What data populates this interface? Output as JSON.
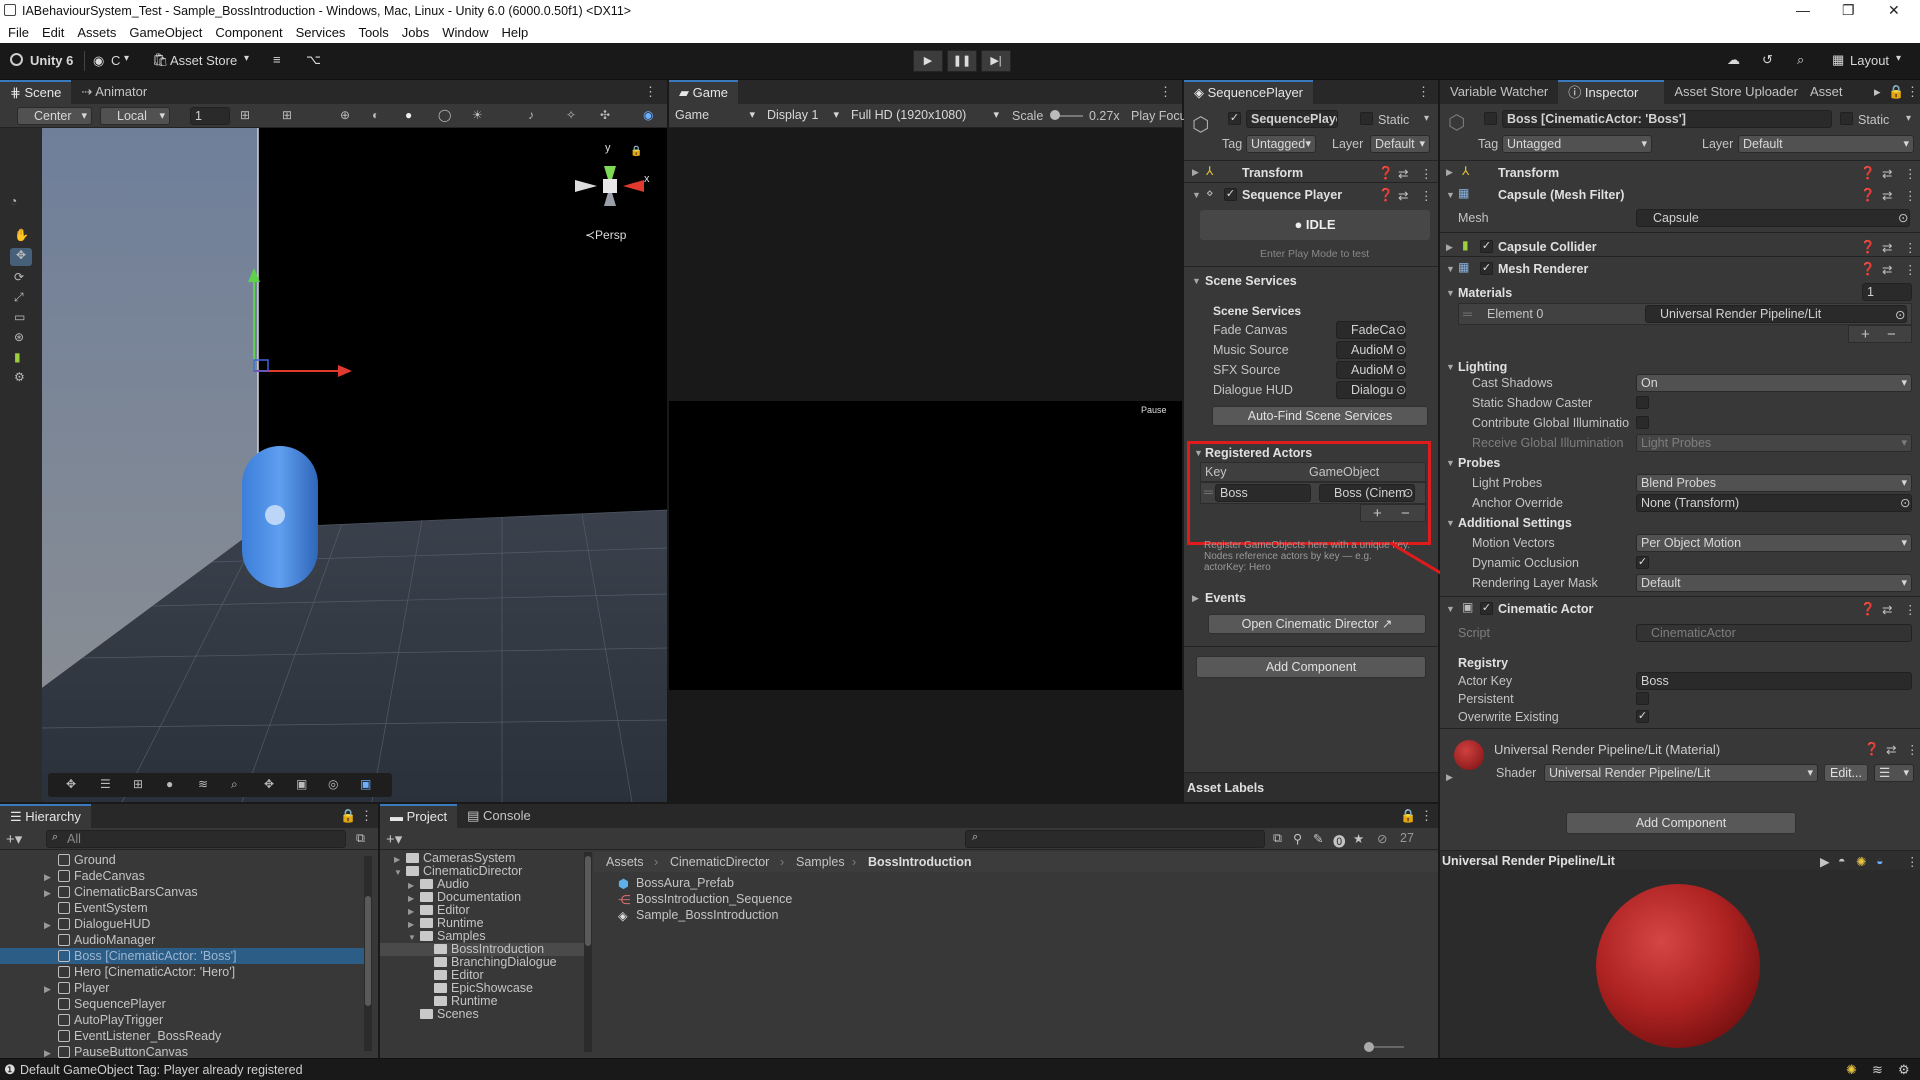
{
  "window": {
    "title": "IABehaviourSystem_Test - Sample_BossIntroduction - Windows, Mac, Linux - Unity 6.0 (6000.0.50f1) <DX11>"
  },
  "menu": [
    "File",
    "Edit",
    "Assets",
    "GameObject",
    "Component",
    "Services",
    "Tools",
    "Jobs",
    "Window",
    "Help"
  ],
  "toolbar": {
    "unity_label": "Unity 6",
    "account_label": "C",
    "asset_store": "Asset Store",
    "layout": "Layout"
  },
  "scene": {
    "tabs": {
      "scene": "Scene",
      "animator": "Animator"
    },
    "pivot": "Center",
    "space": "Local",
    "grid_value": "1",
    "persp_label": "≺Persp",
    "gizmo_y": "y",
    "gizmo_x": "x"
  },
  "game": {
    "tab": "Game",
    "mode": "Game",
    "display": "Display 1",
    "resolution": "Full HD (1920x1080)",
    "scale_label": "Scale",
    "scale_value": "0.27x",
    "play_focused": "Play Focu",
    "pause_text": "Pause"
  },
  "sequence": {
    "tab": "SequencePlayer",
    "object_name": "SequencePlayer",
    "static_label": "Static",
    "tag_label": "Tag",
    "tag_value": "Untagged",
    "layer_label": "Layer",
    "layer_value": "Default",
    "transform": "Transform",
    "component": "Sequence Player",
    "state": "IDLE",
    "hint": "Enter Play Mode to test",
    "scene_services_foldout": "Scene Services",
    "scene_services_header": "Scene Services",
    "services": [
      {
        "label": "Fade Canvas",
        "value": "FadeCa"
      },
      {
        "label": "Music Source",
        "value": "AudioM"
      },
      {
        "label": "SFX Source",
        "value": "AudioM"
      },
      {
        "label": "Dialogue HUD",
        "value": "Dialogu"
      }
    ],
    "auto_find": "Auto-Find Scene Services",
    "registered_actors": "Registered Actors",
    "col_key": "Key",
    "col_gameobject": "GameObject",
    "actor_key": "Boss",
    "actor_object": "Boss (Cinem",
    "help_line1": "Register GameObjects here with a unique key.",
    "help_line2": "Nodes reference actors by key — e.g.",
    "help_line3": "actorKey: Hero",
    "events": "Events",
    "open_director": "Open Cinematic Director ↗",
    "add_component": "Add Component",
    "asset_labels": "Asset Labels"
  },
  "inspector": {
    "tabs": {
      "variable_watcher": "Variable Watcher",
      "inspector": "Inspector",
      "asset_store_uploader": "Asset Store Uploader",
      "asset": "Asset"
    },
    "object_name": "Boss [CinematicActor: 'Boss']",
    "static_label": "Static",
    "tag_label": "Tag",
    "tag_value": "Untagged",
    "layer_label": "Layer",
    "layer_value": "Default",
    "transform": "Transform",
    "mesh_filter": "Capsule (Mesh Filter)",
    "mesh_label": "Mesh",
    "mesh_value": "Capsule",
    "capsule_collider": "Capsule Collider",
    "mesh_renderer": "Mesh Renderer",
    "materials": "Materials",
    "materials_count": "1",
    "element0_label": "Element 0",
    "element0_value": "Universal Render Pipeline/Lit",
    "lighting": "Lighting",
    "cast_shadows_label": "Cast Shadows",
    "cast_shadows_value": "On",
    "static_shadow_label": "Static Shadow Caster",
    "contribute_gi_label": "Contribute Global Illuminatio",
    "receive_gi_label": "Receive Global Illumination",
    "receive_gi_value": "Light Probes",
    "probes": "Probes",
    "light_probes_label": "Light Probes",
    "light_probes_value": "Blend Probes",
    "anchor_label": "Anchor Override",
    "anchor_value": "None (Transform)",
    "additional": "Additional Settings",
    "motion_label": "Motion Vectors",
    "motion_value": "Per Object Motion",
    "dyn_occ_label": "Dynamic Occlusion",
    "render_mask_label": "Rendering Layer Mask",
    "render_mask_value": "Default",
    "cinematic_actor": "Cinematic Actor",
    "script_label": "Script",
    "script_value": "CinematicActor",
    "registry": "Registry",
    "actor_key_label": "Actor Key",
    "actor_key_value": "Boss",
    "persistent_label": "Persistent",
    "overwrite_label": "Overwrite Existing",
    "material_title": "Universal Render Pipeline/Lit (Material)",
    "shader_label": "Shader",
    "shader_value": "Universal Render Pipeline/Lit",
    "edit_label": "Edit...",
    "add_component": "Add Component",
    "preview_title": "Universal Render Pipeline/Lit"
  },
  "hierarchy": {
    "tab": "Hierarchy",
    "search_placeholder": "All",
    "items": [
      {
        "name": "Ground",
        "indent": 0,
        "expand": false
      },
      {
        "name": "FadeCanvas",
        "indent": 0,
        "expand": true
      },
      {
        "name": "CinematicBarsCanvas",
        "indent": 0,
        "expand": true
      },
      {
        "name": "EventSystem",
        "indent": 0,
        "expand": false
      },
      {
        "name": "DialogueHUD",
        "indent": 0,
        "expand": true
      },
      {
        "name": "AudioManager",
        "indent": 0,
        "expand": false
      },
      {
        "name": "Boss [CinematicActor: 'Boss']",
        "indent": 0,
        "expand": false,
        "selected": true
      },
      {
        "name": "Hero [CinematicActor: 'Hero']",
        "indent": 0,
        "expand": false
      },
      {
        "name": "Player",
        "indent": 0,
        "expand": true
      },
      {
        "name": "SequencePlayer",
        "indent": 0,
        "expand": false
      },
      {
        "name": "AutoPlayTrigger",
        "indent": 0,
        "expand": false
      },
      {
        "name": "EventListener_BossReady",
        "indent": 0,
        "expand": false
      },
      {
        "name": "PauseButtonCanvas",
        "indent": 0,
        "expand": true
      }
    ]
  },
  "project": {
    "tabs": {
      "project": "Project",
      "console": "Console"
    },
    "folders": [
      {
        "name": "CamerasSystem",
        "indent": 1,
        "arrow": "▶"
      },
      {
        "name": "CinematicDirector",
        "indent": 1,
        "arrow": "▼"
      },
      {
        "name": "Audio",
        "indent": 2,
        "arrow": "▶"
      },
      {
        "name": "Documentation",
        "indent": 2,
        "arrow": "▶"
      },
      {
        "name": "Editor",
        "indent": 2,
        "arrow": "▶"
      },
      {
        "name": "Runtime",
        "indent": 2,
        "arrow": "▶"
      },
      {
        "name": "Samples",
        "indent": 2,
        "arrow": "▼"
      },
      {
        "name": "BossIntroduction",
        "indent": 3,
        "arrow": "",
        "selected": true
      },
      {
        "name": "BranchingDialogue",
        "indent": 3,
        "arrow": ""
      },
      {
        "name": "Editor",
        "indent": 3,
        "arrow": ""
      },
      {
        "name": "EpicShowcase",
        "indent": 3,
        "arrow": ""
      },
      {
        "name": "Runtime",
        "indent": 3,
        "arrow": ""
      },
      {
        "name": "Scenes",
        "indent": 2,
        "arrow": ""
      }
    ],
    "breadcrumb": [
      "Assets",
      "CinematicDirector",
      "Samples",
      "BossIntroduction"
    ],
    "assets": [
      {
        "name": "BossAura_Prefab",
        "icon": "prefab-icon"
      },
      {
        "name": "BossIntroduction_Sequence",
        "icon": "sequence-icon"
      },
      {
        "name": "Sample_BossIntroduction",
        "icon": "scene-icon"
      }
    ],
    "hidden_count": "27"
  },
  "status": {
    "message": "Default GameObject Tag: Player already registered"
  },
  "colors": {
    "accent": "#3a79bb",
    "selection": "#2c5d87",
    "highlight_box": "#e01b1b"
  }
}
